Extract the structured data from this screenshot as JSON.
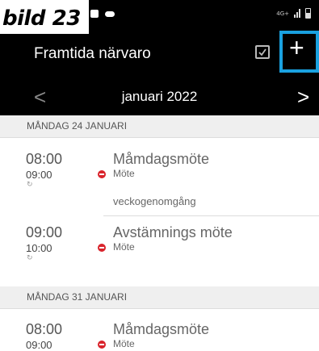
{
  "caption": "bild 23",
  "status": {
    "network": "4G+"
  },
  "appbar": {
    "title": "Framtida närvaro",
    "add_label": "+"
  },
  "month": {
    "prev": "<",
    "label": "januari 2022",
    "next": ">"
  },
  "days": [
    {
      "header": "MÅNDAG 24 JANUARI",
      "events": [
        {
          "start": "08:00",
          "end": "09:00",
          "title": "Måmdagsmöte",
          "type": "Möte",
          "note": "veckogenomgång"
        },
        {
          "start": "09:00",
          "end": "10:00",
          "title": "Avstämnings möte",
          "type": "Möte",
          "note": ""
        }
      ]
    },
    {
      "header": "MÅNDAG 31 JANUARI",
      "events": [
        {
          "start": "08:00",
          "end": "09:00",
          "title": "Måmdagsmöte",
          "type": "Möte",
          "note": ""
        }
      ]
    }
  ],
  "colors": {
    "accent": "#1aa1e0",
    "status_dot": "#d9242c",
    "header_bg": "#000000"
  }
}
